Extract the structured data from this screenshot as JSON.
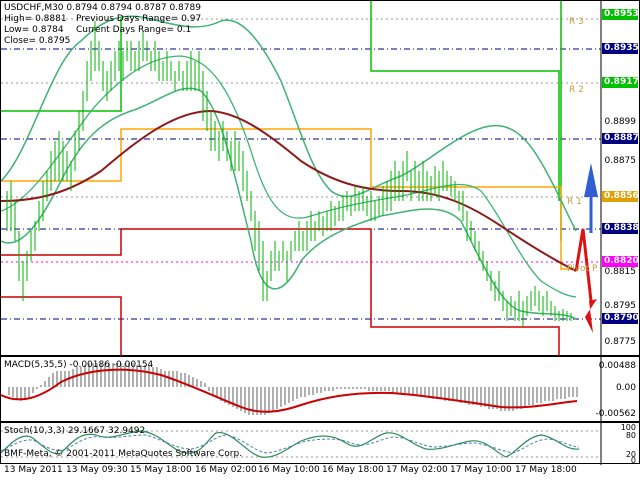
{
  "window": {
    "symbol_line": "USDCHF,M30  0.8794 0.8794 0.8787 0.8789",
    "info_high": "High= 0.8881",
    "info_low": "Low= 0.8784",
    "info_close": "Close= 0.8795",
    "info_prev_range": "Previous Days Range= 0.97",
    "info_curr_range": "Current Days Range= 0.1",
    "copyright": "BMF-Meta, © 2001-2011 MetaQuotes Software Corp."
  },
  "price_axis": {
    "labels": [
      "0.8953",
      "0.8935",
      "0.8917",
      "0.8899",
      "0.8887",
      "0.8875",
      "0.8856",
      "0.8838",
      "0.8820",
      "0.8815",
      "0.8795",
      "0.8790",
      "0.8775"
    ],
    "highlighted": [
      {
        "value": "0.8953",
        "color": "#00c000"
      },
      {
        "value": "0.8935",
        "color": "#000080"
      },
      {
        "value": "0.8917",
        "color": "#00c000"
      },
      {
        "value": "0.8887",
        "color": "#000080"
      },
      {
        "value": "0.8856",
        "color": "#e0a000"
      },
      {
        "value": "0.8838",
        "color": "#000080"
      },
      {
        "value": "0.8820",
        "color": "#ff00ff"
      },
      {
        "value": "0.8790",
        "color": "#000080"
      }
    ]
  },
  "level_labels": {
    "r3": "R 3",
    "r2": "R 2",
    "r1": "R 1",
    "pivot": "Pivot P"
  },
  "macd": {
    "title": "MACD(5,35,5) -0.00186 -0.00154",
    "axis": [
      "0.00488",
      "0.00",
      "-0.00562"
    ]
  },
  "stoch": {
    "title": "Stoch(10,3,3) 29.1667 32.9492",
    "axis": [
      "100",
      "80",
      "20",
      "0"
    ]
  },
  "time_axis": [
    "13 May 2011",
    "13 May 09:30",
    "15 May 18:00",
    "16 May 02:00",
    "16 May 10:00",
    "16 May 18:00",
    "17 May 02:00",
    "17 May 10:00",
    "17 May 18:00"
  ],
  "colors": {
    "candles": "#00b000",
    "bollinger": "#3cb371",
    "ma": "#8b1a1a",
    "support": "#cc0000",
    "resistance": "#00c000",
    "pivot_orange": "#ffa500",
    "arrow_blue": "#3060d0",
    "arrow_red": "#dd1111"
  }
}
